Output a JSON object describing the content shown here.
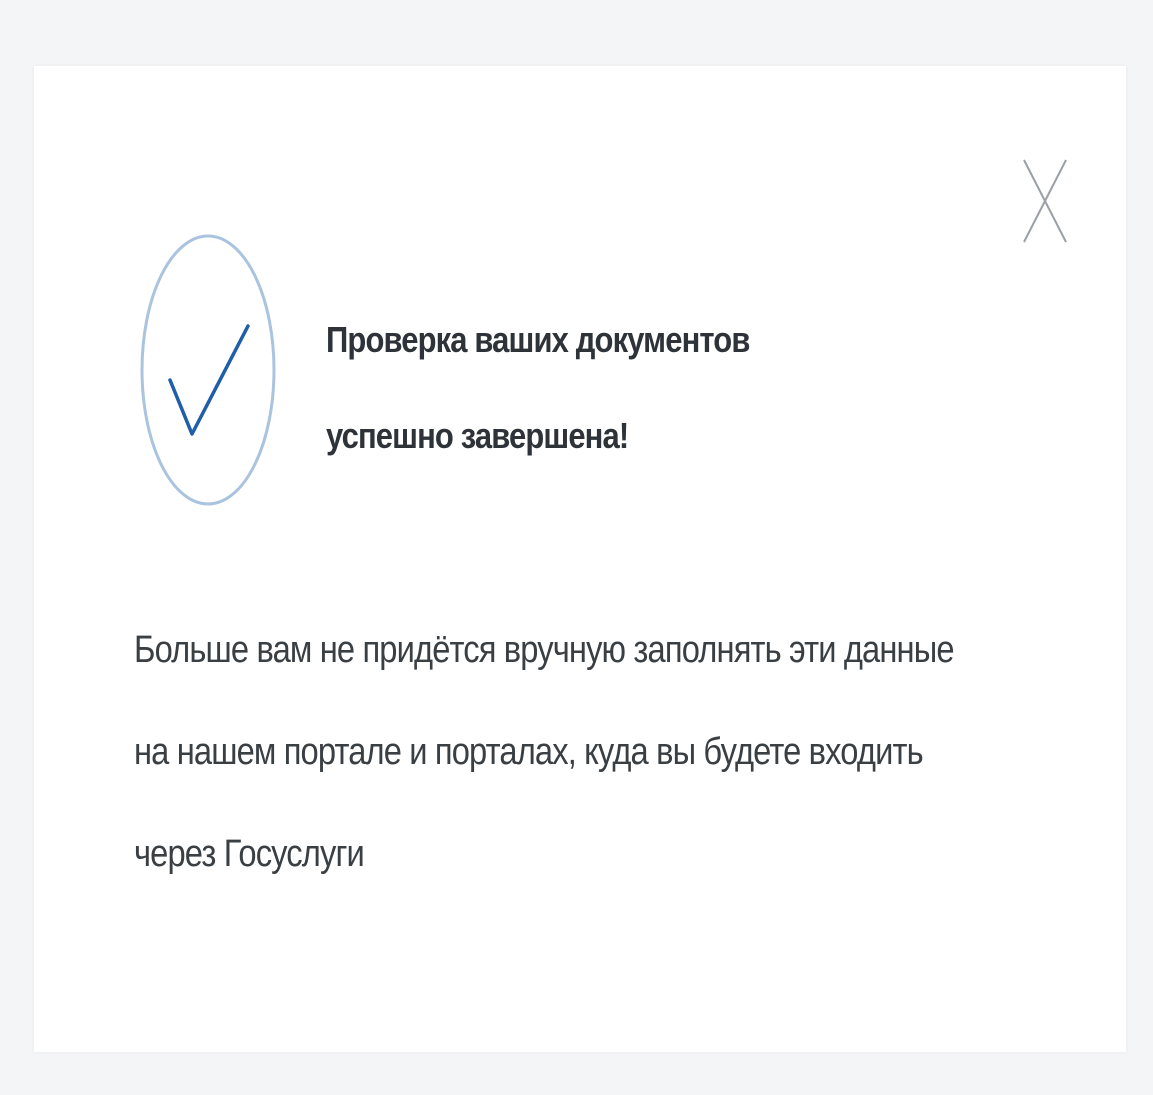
{
  "modal": {
    "title": "Проверка ваших документов успешно завершена!",
    "description": "Больше вам не придётся вручную заполнять эти данные на нашем портале и порталах, куда вы будете входить через Госуслуги",
    "icons": {
      "status": "check-circle-icon",
      "close": "close-icon"
    }
  },
  "colors": {
    "check_stroke": "#1f5ea8",
    "circle_stroke": "#aac3df",
    "text": "#2d3338",
    "close": "#9aa0a6"
  }
}
